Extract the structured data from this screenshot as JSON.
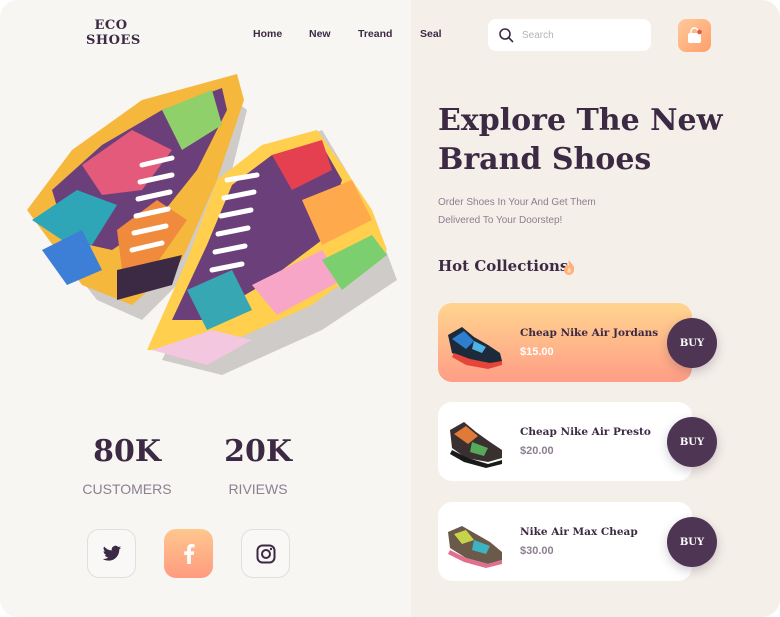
{
  "brand": {
    "line1": "ECO",
    "line2": "SHOES"
  },
  "nav": {
    "items": [
      "Home",
      "New",
      "Treand",
      "Seal"
    ]
  },
  "search": {
    "placeholder": "Search"
  },
  "hero": {
    "title_line1": "Explore The New",
    "title_line2": "Brand Shoes",
    "subtitle_line1": "Order Shoes In Your And Get Them",
    "subtitle_line2": "Delivered To Your Doorstep!"
  },
  "hot": {
    "title": "Hot Collections"
  },
  "products": [
    {
      "name": "Cheap Nike Air Jordans",
      "price": "$15.00",
      "buy": "BUY",
      "highlighted": true
    },
    {
      "name": "Cheap Nike Air Presto",
      "price": "$20.00",
      "buy": "BUY",
      "highlighted": false
    },
    {
      "name": "Nike Air Max Cheap",
      "price": "$30.00",
      "buy": "BUY",
      "highlighted": false
    }
  ],
  "stats": [
    {
      "value": "80K",
      "label": "CUSTOMERS"
    },
    {
      "value": "20K",
      "label": "RIVIEWS"
    }
  ],
  "social": [
    {
      "icon": "twitter-icon",
      "active": false
    },
    {
      "icon": "facebook-icon",
      "active": true
    },
    {
      "icon": "instagram-icon",
      "active": false
    }
  ],
  "colors": {
    "primary": "#3c2a44",
    "buy_button": "#4d3553",
    "accent_gradient_start": "#ffd58f",
    "accent_gradient_end": "#ff9d86",
    "muted_text": "#8c7f90"
  }
}
